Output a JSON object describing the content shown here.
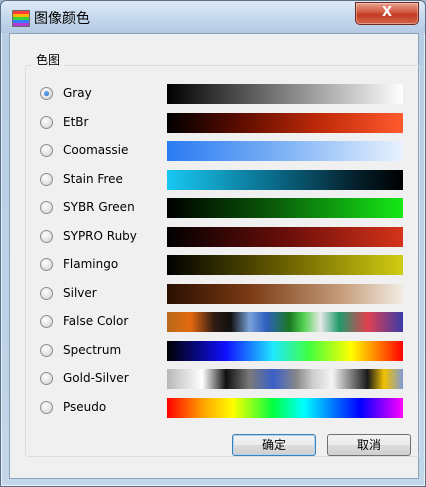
{
  "window": {
    "title": "图像颜色",
    "close_symbol": "X"
  },
  "group": {
    "label": "色图"
  },
  "colormaps": [
    {
      "label": "Gray",
      "selected": true,
      "gradient": "linear-gradient(90deg,#000000,#ffffff)"
    },
    {
      "label": "EtBr",
      "selected": false,
      "gradient": "linear-gradient(90deg,#000000,#5a0c00 30%,#c02a08 65%,#ff5a2e)"
    },
    {
      "label": "Coomassie",
      "selected": false,
      "gradient": "linear-gradient(90deg,#2a7bf2,#7fb3f5 50%,#e8f2ff)"
    },
    {
      "label": "Stain Free",
      "selected": false,
      "gradient": "linear-gradient(90deg,#18c8f2,#0a6b8a 45%,#05202c 80%,#000000)"
    },
    {
      "label": "SYBR Green",
      "selected": false,
      "gradient": "linear-gradient(90deg,#000000,#0a5a0a 45%,#15e815)"
    },
    {
      "label": "SYPRO Ruby",
      "selected": false,
      "gradient": "linear-gradient(90deg,#000000,#6a0e0a 50%,#d5331a)"
    },
    {
      "label": "Flamingo",
      "selected": false,
      "gradient": "linear-gradient(90deg,#000000,#6a6000 50%,#d1cc12)"
    },
    {
      "label": "Silver",
      "selected": false,
      "gradient": "linear-gradient(90deg,#2b0f00,#7a3a14 35%,#c8a07e 75%,#f2ece4)"
    },
    {
      "label": "False Color",
      "selected": false,
      "gradient": "linear-gradient(90deg,#b86a1a,#e46a10 10%,#2e1a12 20%,#111111 27%,#7aa2d8 35%,#2e5fc0 42%,#1a7a22 52%,#52d152 58%,#e8e8e8 65%,#1f9a6a 73%,#e04050 85%,#3a3aa8)"
    },
    {
      "label": "Spectrum",
      "selected": false,
      "gradient": "linear-gradient(90deg,#000000,#1010ff 25%,#20e8ff 45%,#40ff40 60%,#ffff00 78%,#ff0000)"
    },
    {
      "label": "Gold-Silver",
      "selected": false,
      "gradient": "linear-gradient(90deg,#b8b8b8,#ffffff 15%,#111111 25%,#7a7a7a 35%,#3a5fc8 45%,#888888 55%,#cfcfcf 62%,#f4f4f4 70%,#1a1a1a 85%,#f2c200 92%,#7f9ad2)"
    },
    {
      "label": "Pseudo",
      "selected": false,
      "gradient": "linear-gradient(90deg,#ff0000,#ffa000 15%,#ffff00 28%,#00ff40 45%,#00ffff 58%,#0066ff 72%,#0000ff 82%,#ff00ff)"
    }
  ],
  "buttons": {
    "ok": "确定",
    "cancel": "取消"
  }
}
